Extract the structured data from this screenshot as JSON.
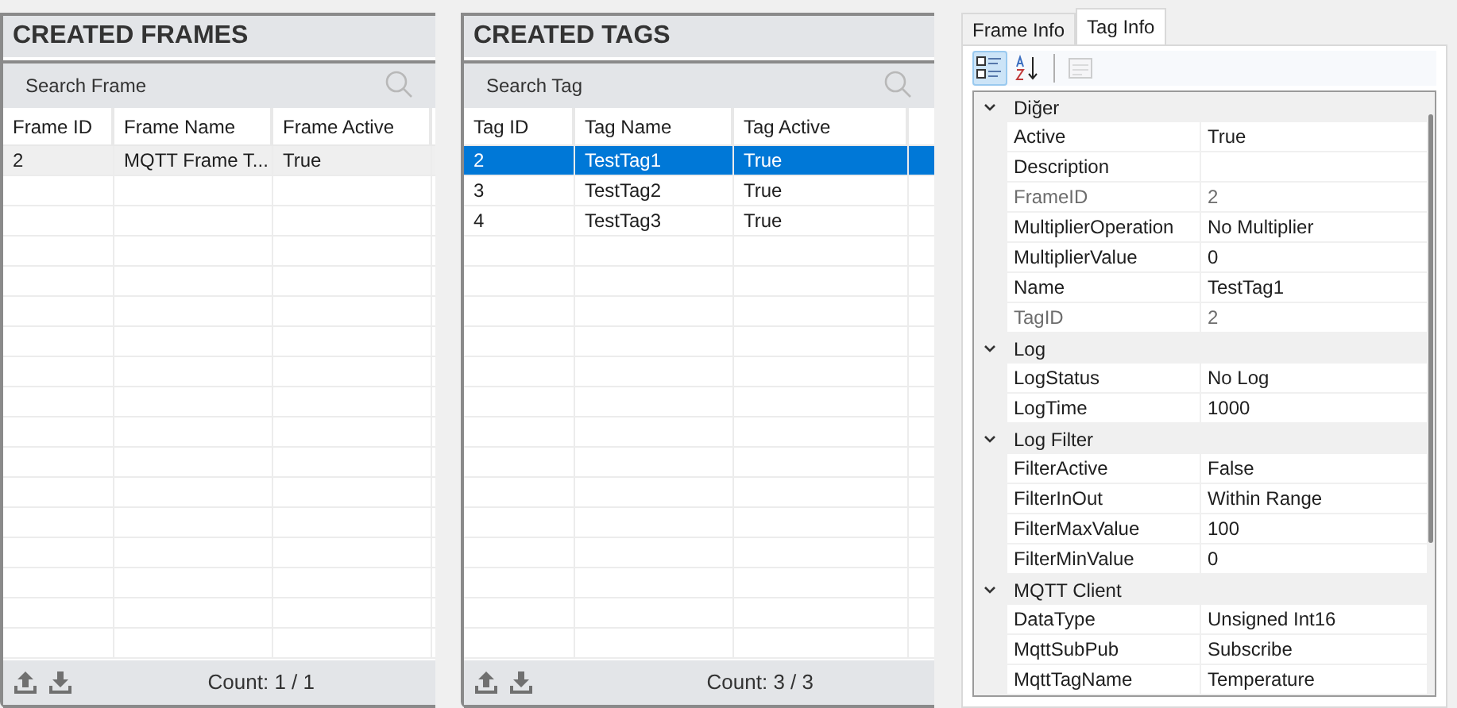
{
  "panels": [
    {
      "title": "CREATED FRAMES",
      "search_placeholder": "Search Frame",
      "columns": [
        "Frame ID",
        "Frame Name",
        "Frame Active"
      ],
      "rows": [
        {
          "cells": [
            "2",
            "MQTT Frame T...",
            "True"
          ],
          "selected": false
        }
      ],
      "count": "Count: 1 / 1"
    },
    {
      "title": "CREATED TAGS",
      "search_placeholder": "Search Tag",
      "columns": [
        "Tag ID",
        "Tag Name",
        "Tag Active"
      ],
      "rows": [
        {
          "cells": [
            "2",
            "TestTag1",
            "True"
          ],
          "selected": true
        },
        {
          "cells": [
            "3",
            "TestTag2",
            "True"
          ],
          "selected": false
        },
        {
          "cells": [
            "4",
            "TestTag3",
            "True"
          ],
          "selected": false
        }
      ],
      "count": "Count: 3 / 3"
    }
  ],
  "inspector": {
    "tabs": [
      {
        "label": "Frame Info",
        "selected": false
      },
      {
        "label": "Tag Info",
        "selected": true
      }
    ],
    "toolbar": [
      {
        "kind": "categorized",
        "selected": true,
        "disabled": false
      },
      {
        "kind": "alphabetical",
        "selected": false,
        "disabled": false
      },
      {
        "kind": "pages",
        "selected": false,
        "disabled": true
      }
    ],
    "categories": [
      {
        "label": "Diğer",
        "expanded": true,
        "properties": [
          {
            "name": "Active",
            "value": "True",
            "disabled": false
          },
          {
            "name": "Description",
            "disabled": false
          },
          {
            "name": "FrameID",
            "value": "2",
            "disabled": true
          },
          {
            "name": "MultiplierOperation",
            "value": "No Multiplier",
            "disabled": false
          },
          {
            "name": "MultiplierValue",
            "value": "0",
            "disabled": false
          },
          {
            "name": "Name",
            "value": "TestTag1",
            "disabled": false
          },
          {
            "name": "TagID",
            "value": "2",
            "disabled": true
          }
        ]
      },
      {
        "label": "Log",
        "expanded": true,
        "properties": [
          {
            "name": "LogStatus",
            "value": "No Log",
            "disabled": false
          },
          {
            "name": "LogTime",
            "value": "1000",
            "disabled": false
          }
        ]
      },
      {
        "label": "Log Filter",
        "expanded": true,
        "properties": [
          {
            "name": "FilterActive",
            "value": "False",
            "disabled": false
          },
          {
            "name": "FilterInOut",
            "value": "Within Range",
            "disabled": false
          },
          {
            "name": "FilterMaxValue",
            "value": "100",
            "disabled": false
          },
          {
            "name": "FilterMinValue",
            "value": "0",
            "disabled": false
          }
        ]
      },
      {
        "label": "MQTT Client",
        "expanded": true,
        "properties": [
          {
            "name": "DataType",
            "value": "Unsigned Int16",
            "disabled": false
          },
          {
            "name": "MqttSubPub",
            "value": "Subscribe",
            "disabled": false
          },
          {
            "name": "MqttTagName",
            "value": "Temperature",
            "disabled": false
          }
        ]
      }
    ]
  }
}
